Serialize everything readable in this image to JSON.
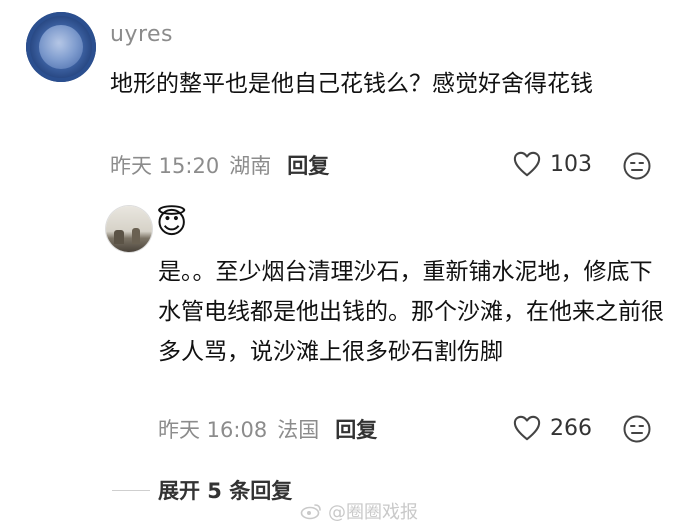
{
  "comment": {
    "username": "uyres",
    "text": "地形的整平也是他自己花钱么？感觉好舍得花钱",
    "time": "昨天 15:20",
    "location": "湖南",
    "reply_label": "回复",
    "likes": "103"
  },
  "reply": {
    "emoji": "😇",
    "text": "是。。至少烟台清理沙石，重新铺水泥地，修底下水管电线都是他出钱的。那个沙滩，在他来之前很多人骂，说沙滩上很多砂石割伤脚",
    "time": "昨天 16:08",
    "location": "法国",
    "reply_label": "回复",
    "likes": "266"
  },
  "expand_label": "展开 5 条回复",
  "watermark": "@圈圈戏报",
  "colors": {
    "meta": "#8c8c8c",
    "text": "#111111",
    "watermark": "#c9c9c9"
  }
}
